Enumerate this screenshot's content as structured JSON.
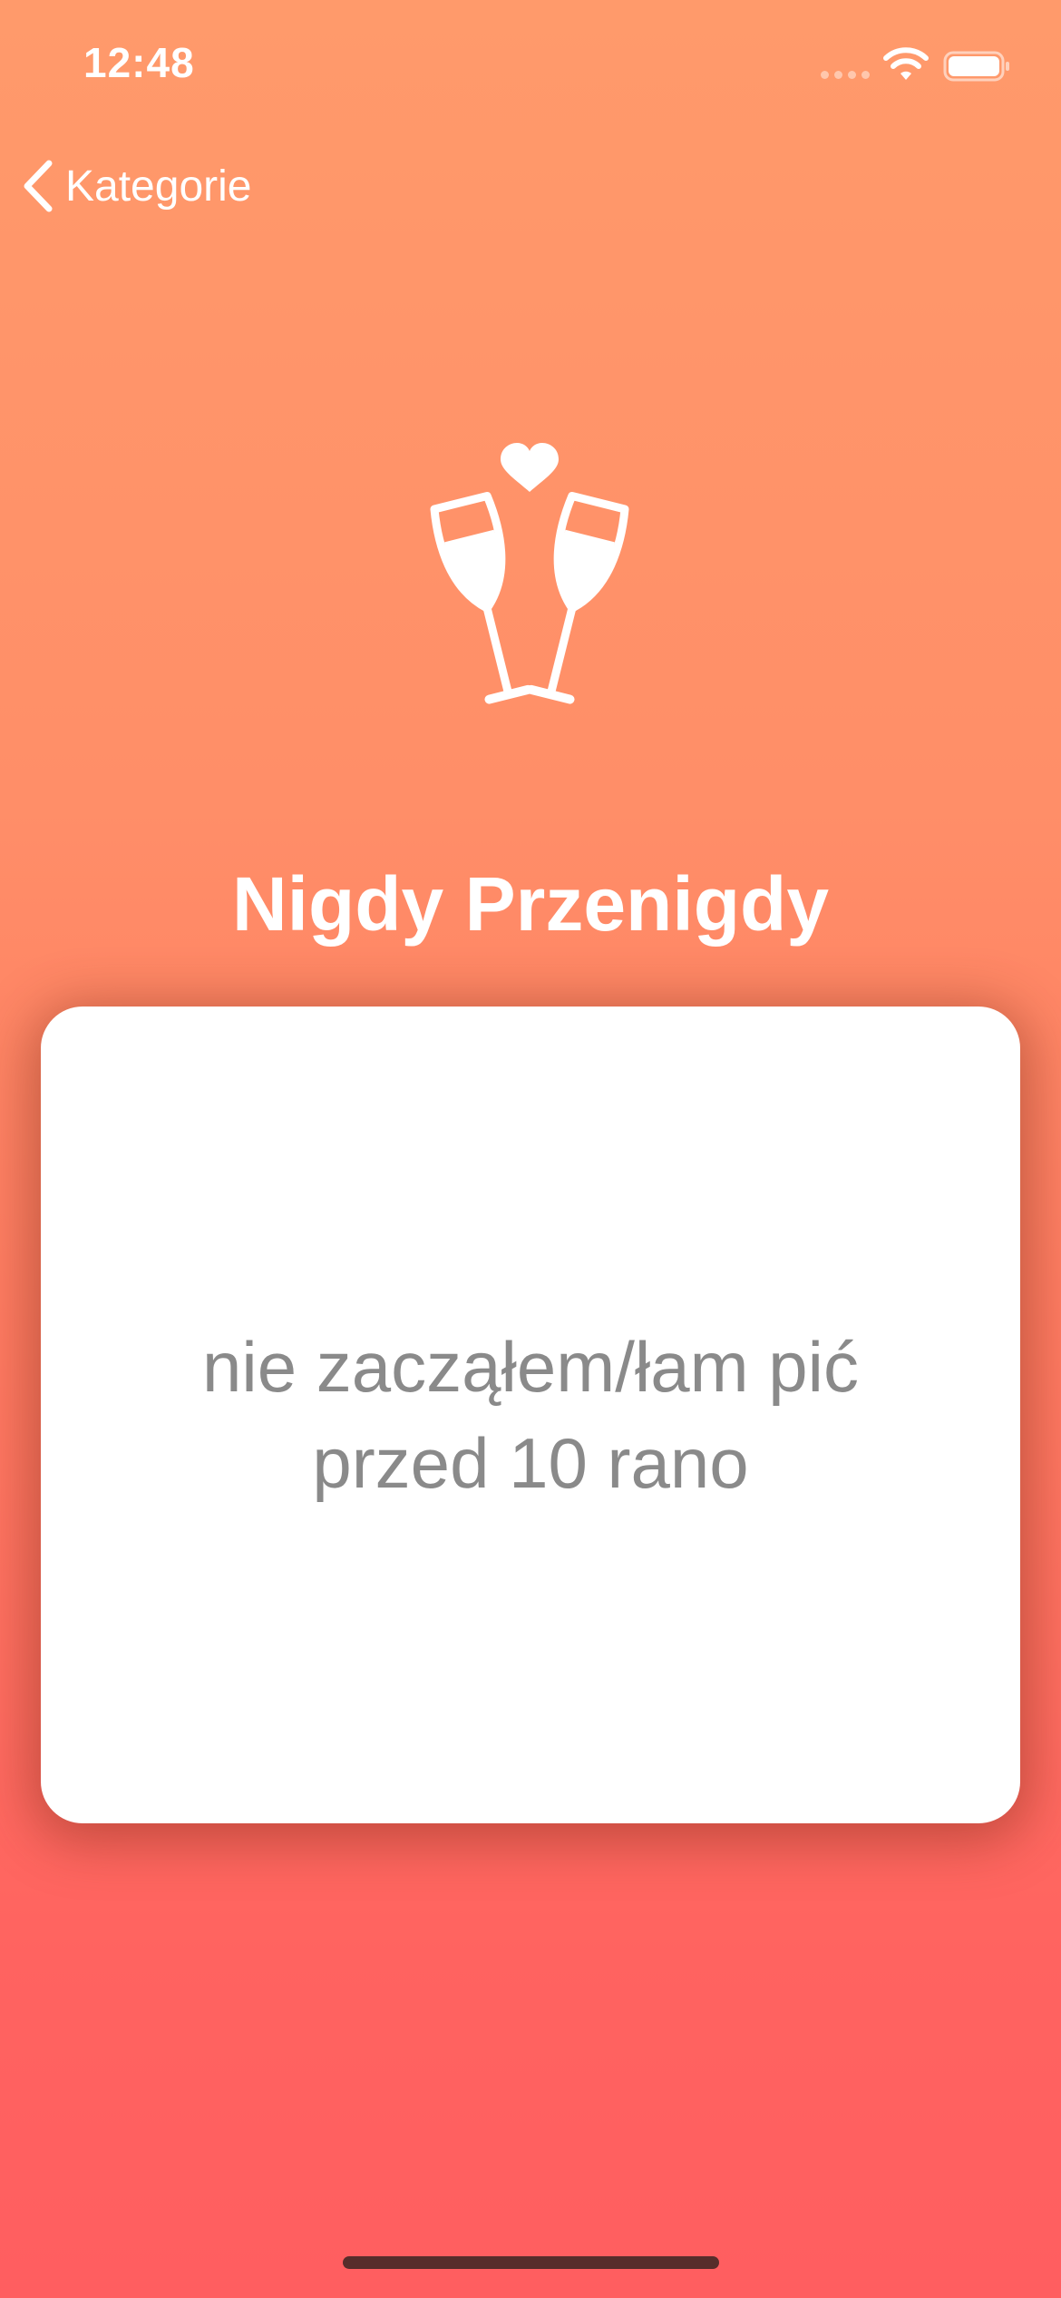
{
  "status_bar": {
    "time": "12:48",
    "icons": [
      "signal-icon",
      "wifi-icon",
      "battery-icon"
    ]
  },
  "navigation": {
    "back_label": "Kategorie",
    "back_icon": "chevron-left-icon"
  },
  "hero": {
    "icon": "cheers-icon"
  },
  "category": {
    "title": "Nigdy Przenigdy"
  },
  "card": {
    "question": "nie zacząłem/łam pić przed 10 rano"
  },
  "colors": {
    "gradient_top": "#ff9a6b",
    "gradient_bottom": "#ff5e60",
    "card_background": "#ffffff",
    "question_text": "#8a8a8a",
    "title_text": "#ffffff"
  }
}
